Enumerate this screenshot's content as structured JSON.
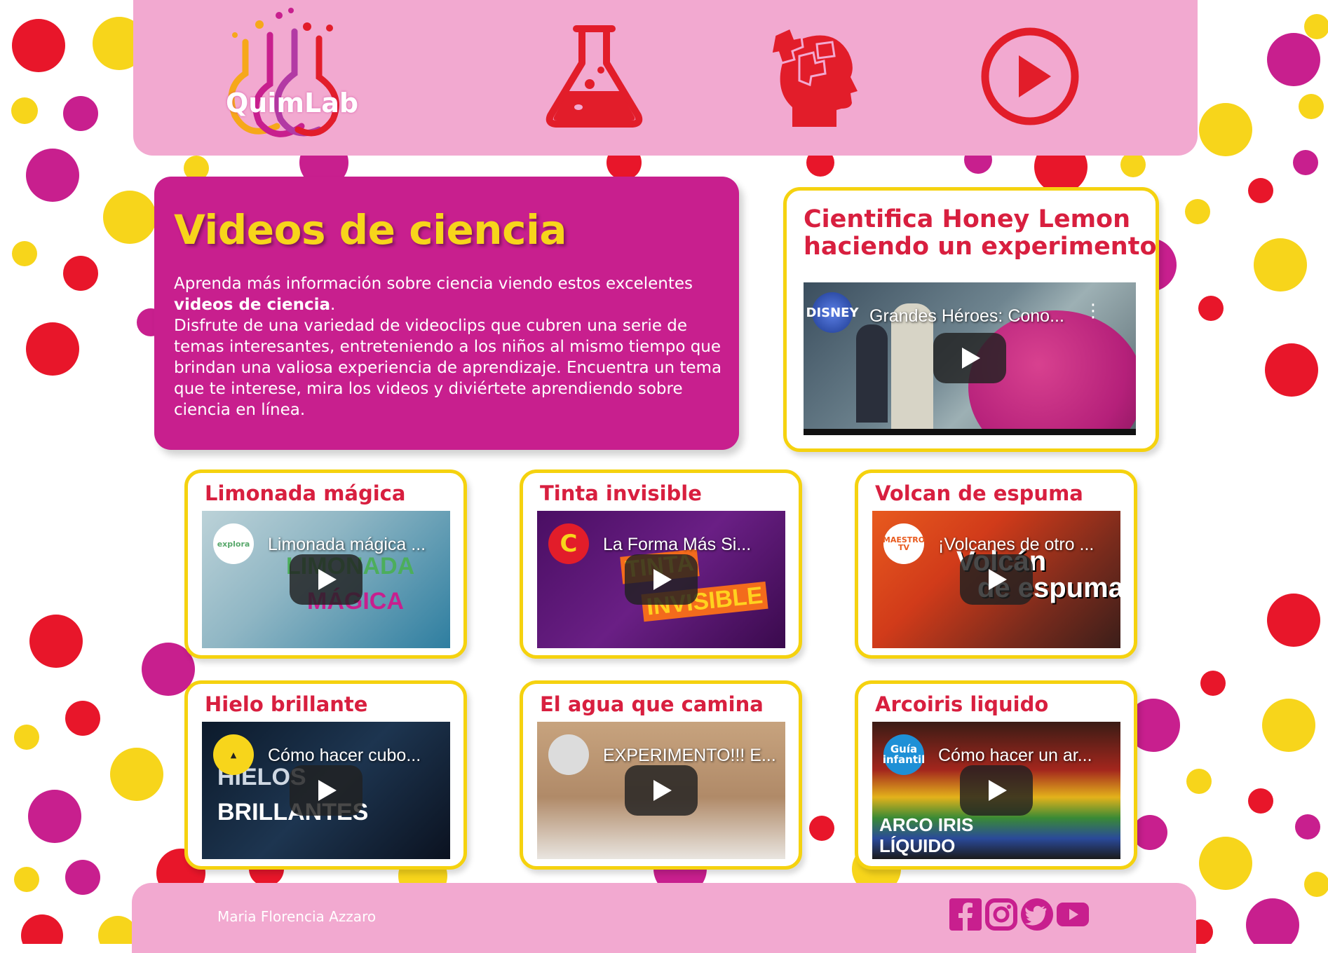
{
  "header": {
    "logo_text": "QuimLab",
    "nav": [
      {
        "name": "flask-icon"
      },
      {
        "name": "brain-puzzle-icon"
      },
      {
        "name": "play-circle-icon"
      }
    ]
  },
  "intro": {
    "title": "Videos de ciencia",
    "line1": "Aprenda más información sobre ciencia viendo estos excelentes",
    "line1_bold": "videos de ciencia",
    "line1_end": ".",
    "paragraph2": "Disfrute de una variedad de videoclips que cubren una serie de temas interesantes, entreteniendo a los niños al mismo tiempo que brindan una valiosa experiencia de aprendizaje. Encuentra un tema que te interese, mira los videos y diviértete aprendiendo sobre ciencia en línea."
  },
  "feature": {
    "title_line1": "Cientifica Honey Lemon",
    "title_line2": "haciendo un experimento",
    "video_title": "Grandes Héroes: Cono...",
    "channel": "DISNEY"
  },
  "videos": [
    {
      "title": "Limonada mágica",
      "video_title": "Limonada mágica ...",
      "avatar": "explora",
      "overlay1": "LIMONADA",
      "overlay2": "MÁGICA"
    },
    {
      "title": "Tinta invisible",
      "video_title": "La Forma Más Si...",
      "avatar": "C",
      "overlay1": "TINTA",
      "overlay2": "INVISIBLE"
    },
    {
      "title": "Volcan de espuma",
      "video_title": "¡Volcanes de otro ...",
      "avatar": "MAESTRO TV",
      "overlay1": "Volcán",
      "overlay2": "de espuma"
    },
    {
      "title": "Hielo brillante",
      "video_title": "Cómo hacer cubo...",
      "avatar": "▲",
      "overlay1": "HIELOS",
      "overlay2": "BRILLANTES"
    },
    {
      "title": "El agua que camina",
      "video_title": "EXPERIMENTO!!! E...",
      "avatar": "",
      "overlay1": "",
      "overlay2": ""
    },
    {
      "title": "Arcoiris liquido",
      "video_title": "Cómo hacer un ar...",
      "avatar": "Guía infantil",
      "overlay1": "ARCO IRIS",
      "overlay2": "LÍQUIDO"
    }
  ],
  "footer": {
    "author": "Maria Florencia Azzaro",
    "social": [
      "facebook-icon",
      "instagram-icon",
      "twitter-icon",
      "youtube-icon"
    ]
  },
  "colors": {
    "pink_bar": "#f2a9d0",
    "magenta": "#c81f8e",
    "yellow": "#f5d20f",
    "red": "#e21d2a"
  }
}
